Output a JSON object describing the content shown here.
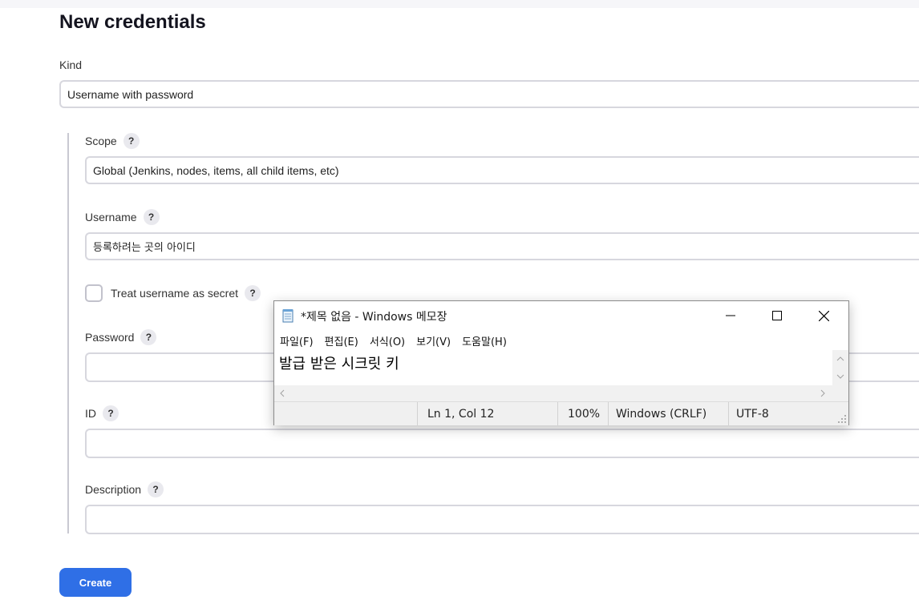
{
  "page": {
    "title": "New credentials"
  },
  "form": {
    "kind": {
      "label": "Kind",
      "value": "Username with password"
    },
    "scope": {
      "label": "Scope",
      "value": "Global (Jenkins, nodes, items, all child items, etc)"
    },
    "username": {
      "label": "Username",
      "value": "등록하려는 곳의 아이디"
    },
    "treat_secret": {
      "label": "Treat username as secret",
      "checked": false
    },
    "password": {
      "label": "Password",
      "value": ""
    },
    "id": {
      "label": "ID",
      "value": ""
    },
    "description": {
      "label": "Description",
      "value": ""
    },
    "help_glyph": "?",
    "create_label": "Create"
  },
  "notepad": {
    "title": "*제목 없음 - Windows 메모장",
    "menu": [
      "파일(F)",
      "편집(E)",
      "서식(O)",
      "보기(V)",
      "도움말(H)"
    ],
    "content": "발급 받은 시크릿 키",
    "status": {
      "position": "Ln 1, Col 12",
      "zoom": "100%",
      "line_ending": "Windows (CRLF)",
      "encoding": "UTF-8"
    }
  },
  "colors": {
    "accent": "#2f6fe6",
    "field_border": "#d7d7de"
  }
}
